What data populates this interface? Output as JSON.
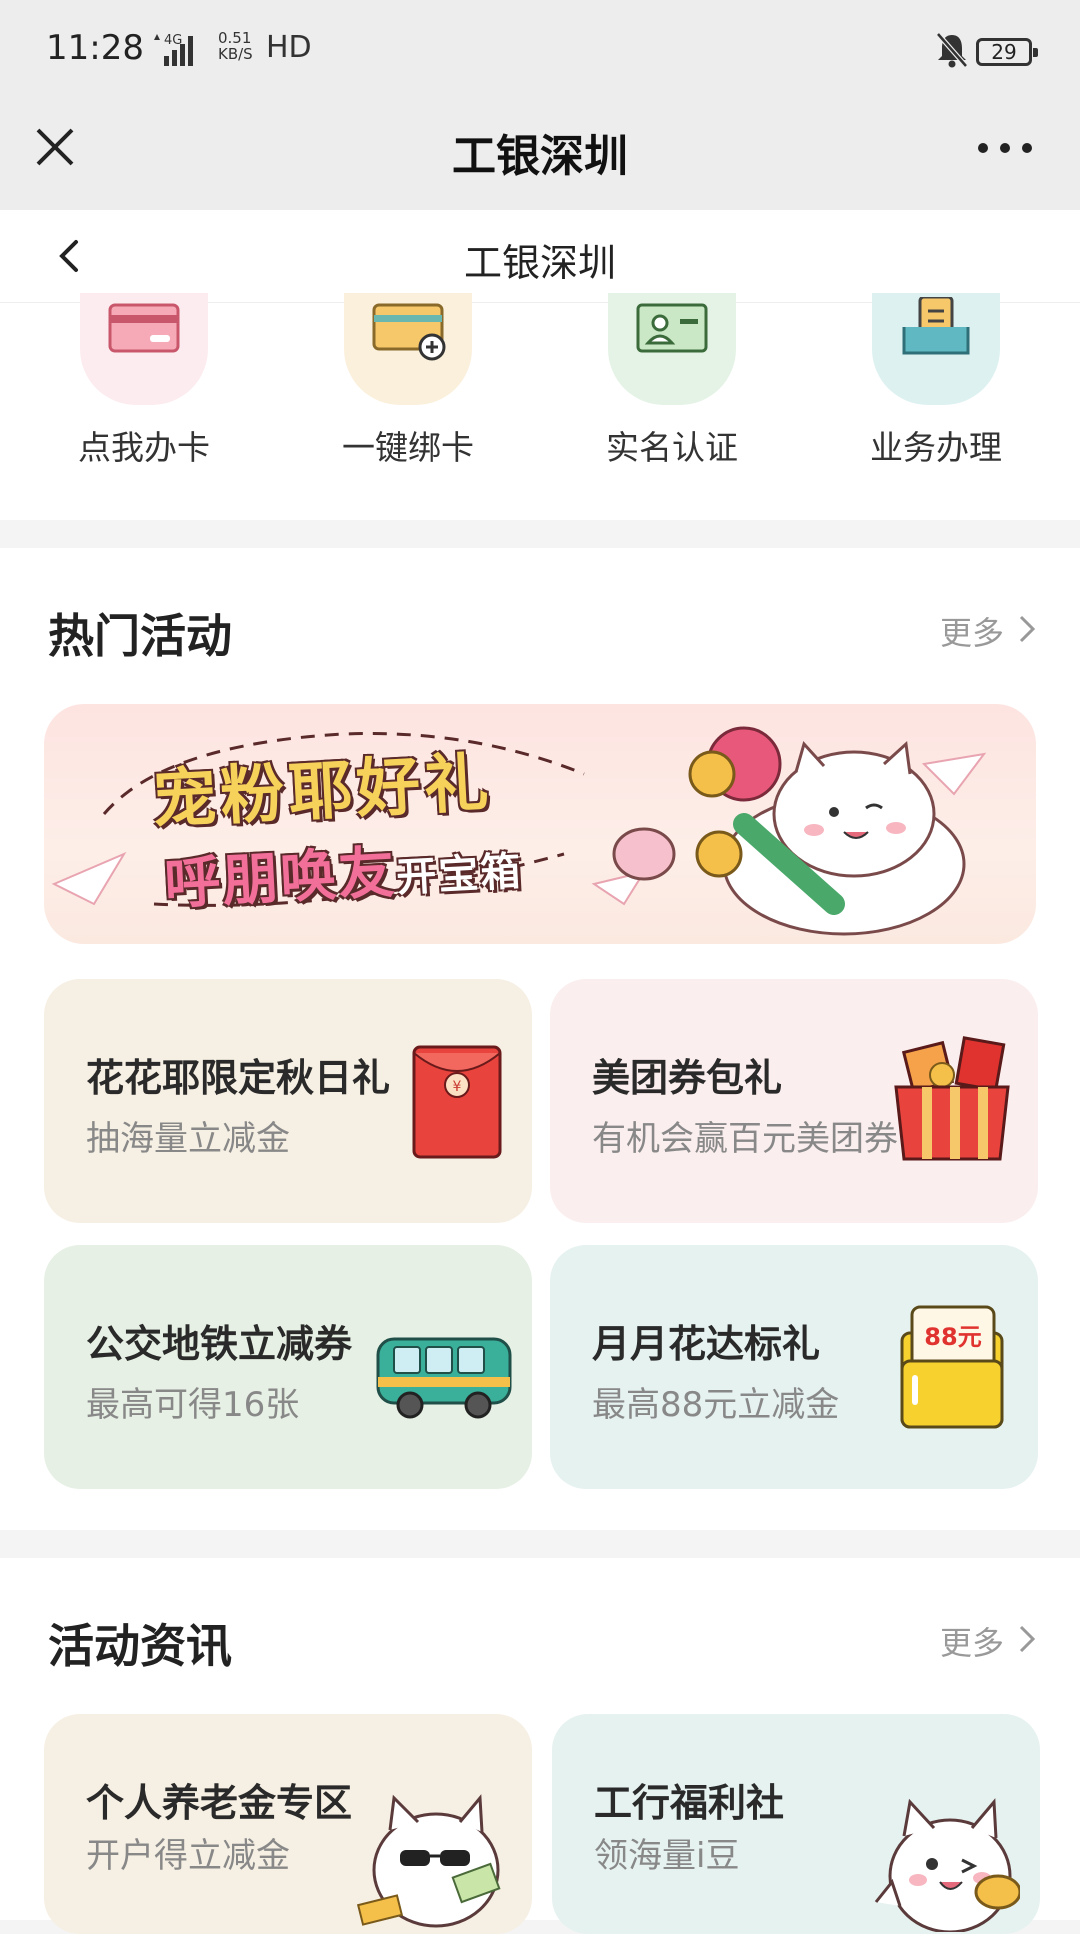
{
  "status_bar": {
    "time": "11:28",
    "network": "4G",
    "speed_value": "0.51",
    "speed_unit": "KB/S",
    "hd": "HD",
    "battery": "29"
  },
  "title_bar": {
    "title": "工银深圳"
  },
  "page_header": {
    "title": "工银深圳"
  },
  "services": [
    {
      "label": "点我办卡",
      "icon": "card-icon",
      "bg": "#fcecef"
    },
    {
      "label": "一键绑卡",
      "icon": "card-add-icon",
      "bg": "#fbf0dc"
    },
    {
      "label": "实名认证",
      "icon": "id-card-icon",
      "bg": "#e4f3e6"
    },
    {
      "label": "业务办理",
      "icon": "document-icon",
      "bg": "#ddf1f1"
    }
  ],
  "hot": {
    "title": "热门活动",
    "more": "更多",
    "banner": {
      "line1": "宠粉耶好礼",
      "line2": "呼朋唤友",
      "line2_small": "开宝箱"
    },
    "cards": [
      {
        "title": "花花耶限定秋日礼",
        "subtitle": "抽海量立减金",
        "bg": "#f6efe3",
        "art": "red-envelope-icon"
      },
      {
        "title": "美团券包礼",
        "subtitle": "有机会赢百元美团券",
        "bg": "#fbeeee",
        "art": "gift-box-icon"
      },
      {
        "title": "公交地铁立减券",
        "subtitle": "最高可得16张",
        "bg": "#e6f0e4",
        "art": "bus-icon"
      },
      {
        "title": "月月花达标礼",
        "subtitle": "最高88元立减金",
        "bg": "#e6f2f0",
        "art": "coupon-88-icon",
        "art_text": "88元"
      }
    ]
  },
  "news": {
    "title": "活动资讯",
    "more": "更多",
    "cards": [
      {
        "title": "个人养老金专区",
        "subtitle": "开户得立减金",
        "bg": "#f6efe3"
      },
      {
        "title": "工行福利社",
        "subtitle": "领海量i豆",
        "bg": "#e6f2f0"
      }
    ]
  }
}
